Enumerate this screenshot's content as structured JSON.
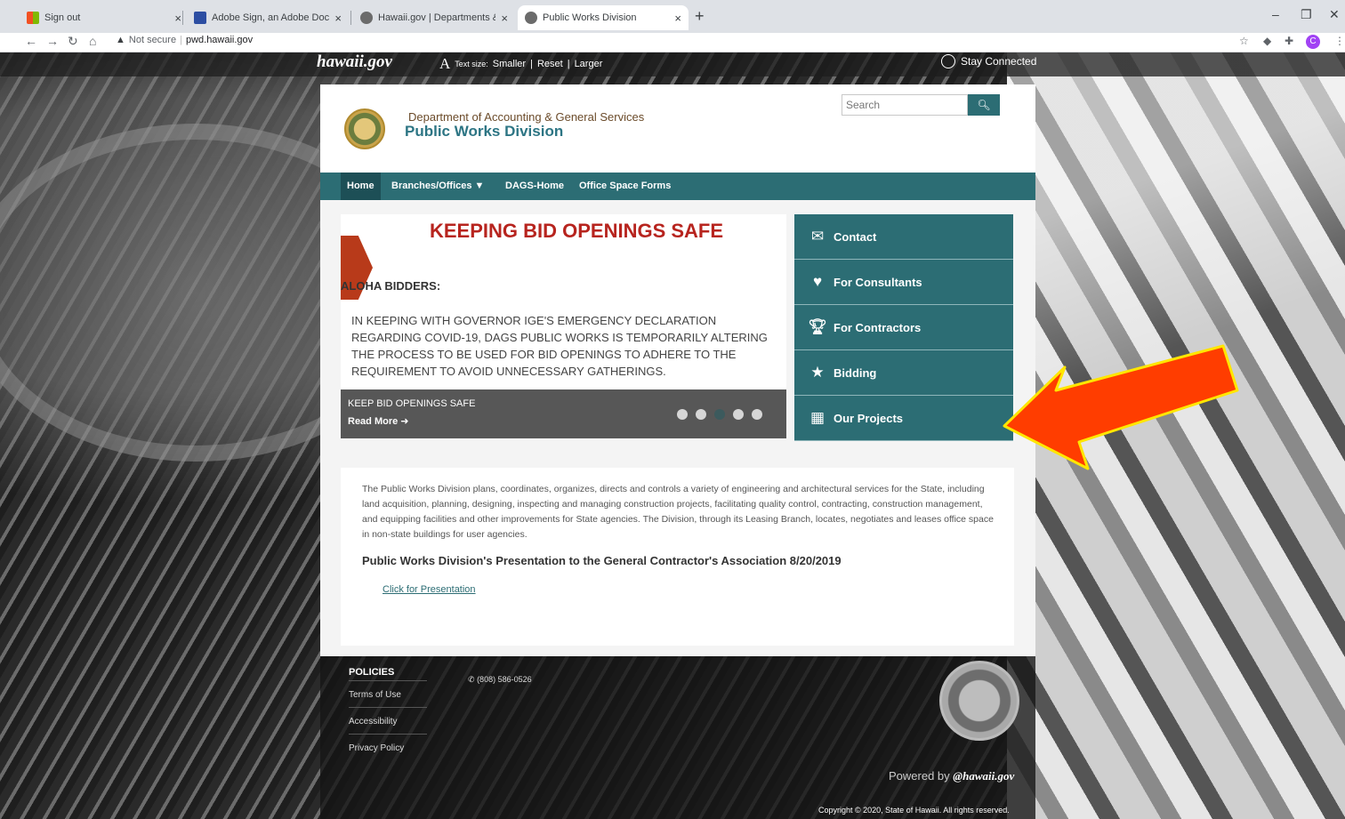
{
  "browser": {
    "tabs": [
      {
        "title": "Sign out",
        "active": false,
        "favicon_color": "#f25022"
      },
      {
        "title": "Adobe Sign, an Adobe Documen",
        "active": false,
        "favicon_color": "#2d4ea2"
      },
      {
        "title": "Hawaii.gov | Departments & Age",
        "active": false,
        "favicon_color": "#6b6b6b"
      },
      {
        "title": "Public Works Division",
        "active": true,
        "favicon_color": "#6b6b6b"
      }
    ],
    "security_label": "Not secure",
    "url": "pwd.hawaii.gov",
    "profile_initial": "C"
  },
  "topbar": {
    "logo": "hawaii.gov",
    "textsize_label": "Text size:",
    "smaller": "Smaller",
    "reset": "Reset",
    "larger": "Larger",
    "stay_connected": "Stay Connected"
  },
  "header": {
    "dept": "Department of Accounting & General Services",
    "division": "Public Works Division",
    "search_placeholder": "Search"
  },
  "nav": [
    {
      "label": "Home",
      "active": true
    },
    {
      "label": "Branches/Offices ▼",
      "active": false
    },
    {
      "label": "DAGS-Home",
      "active": false
    },
    {
      "label": "Office Space Forms",
      "active": false
    }
  ],
  "slide": {
    "title": "KEEPING BID  OPENINGS SAFE",
    "greeting": "ALOHA BIDDERS:",
    "body": "IN KEEPING WITH GOVERNOR IGE'S EMERGENCY  DECLARATION REGARDING COVID-19, DAGS PUBLIC WORKS  IS TEMPORARILY ALTERING THE PROCESS TO BE USED FOR BID OPENINGS TO ADHERE TO THE REQUIREMENT TO AVOID  UNNECESSARY GATHERINGS.",
    "caption": "KEEP BID OPENINGS SAFE",
    "read_more": "Read More ➜"
  },
  "quick_links": [
    {
      "label": "Contact",
      "icon": "envelope-icon"
    },
    {
      "label": "For Consultants",
      "icon": "heart-icon"
    },
    {
      "label": "For Contractors",
      "icon": "trophy-icon"
    },
    {
      "label": "Bidding",
      "icon": "star-icon"
    },
    {
      "label": "Our Projects",
      "icon": "film-icon"
    }
  ],
  "content": {
    "description": "The Public Works Division plans, coordinates, organizes, directs and controls a variety of engineering and architectural services for the State, including land acquisition, planning, designing, inspecting and managing construction projects, facilitating quality control, contracting, construction management, and equipping facilities and other improvements for State agencies. The Division, through its Leasing Branch, locates, negotiates and leases office space in non-state buildings for user agencies.",
    "heading": "Public Works Division's Presentation to the General Contractor's Association 8/20/2019",
    "link": "Click for Presentation"
  },
  "footer": {
    "policies": "POLICIES",
    "links": [
      "Terms of Use",
      "Accessibility",
      "Privacy Policy"
    ],
    "phone": "(808) 586-0526",
    "powered_by": "Powered by",
    "powered_brand": "@hawaii.gov",
    "copyright": "Copyright © 2020, State of Hawaii. All rights reserved."
  },
  "colors": {
    "accent": "#2c6d74",
    "title_red": "#b7241e",
    "arrow_fill": "#ff3d00",
    "arrow_stroke": "#ffe600"
  }
}
